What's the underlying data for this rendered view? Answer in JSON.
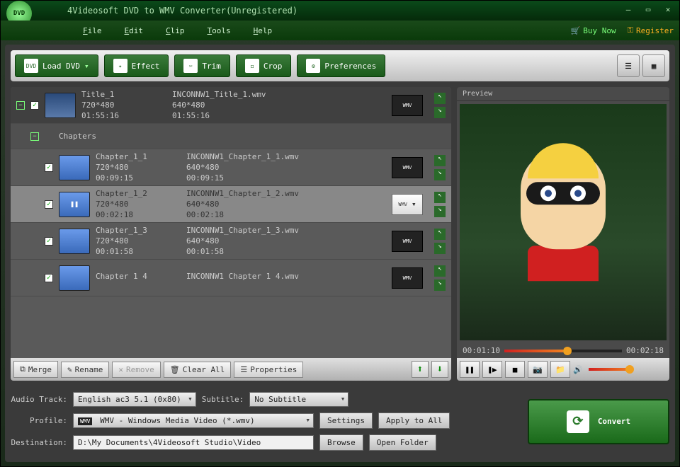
{
  "window": {
    "title": "4Videosoft DVD to WMV Converter(Unregistered)",
    "logo_text": "DVD"
  },
  "menu": {
    "file": "File",
    "edit": "Edit",
    "clip": "Clip",
    "tools": "Tools",
    "help": "Help",
    "buy_now": "Buy Now",
    "register": "Register"
  },
  "toolbar": {
    "load_dvd": "Load DVD",
    "effect": "Effect",
    "trim": "Trim",
    "crop": "Crop",
    "preferences": "Preferences"
  },
  "files": {
    "title_row": {
      "name": "Title_1",
      "resolution": "720*480",
      "duration": "01:55:16",
      "out_name": "INCONNW1_Title_1.wmv",
      "out_resolution": "640*480",
      "out_duration": "01:55:16"
    },
    "chapters_header": "Chapters",
    "chapters": [
      {
        "name": "Chapter_1_1",
        "resolution": "720*480",
        "duration": "00:09:15",
        "out_name": "INCONNW1_Chapter_1_1.wmv",
        "out_resolution": "640*480",
        "out_duration": "00:09:15",
        "selected": false
      },
      {
        "name": "Chapter_1_2",
        "resolution": "720*480",
        "duration": "00:02:18",
        "out_name": "INCONNW1_Chapter_1_2.wmv",
        "out_resolution": "640*480",
        "out_duration": "00:02:18",
        "selected": true
      },
      {
        "name": "Chapter_1_3",
        "resolution": "720*480",
        "duration": "00:01:58",
        "out_name": "INCONNW1_Chapter_1_3.wmv",
        "out_resolution": "640*480",
        "out_duration": "00:01:58",
        "selected": false
      },
      {
        "name": "Chapter 1 4",
        "resolution": "",
        "duration": "",
        "out_name": "INCONNW1 Chapter 1 4.wmv",
        "out_resolution": "",
        "out_duration": "",
        "selected": false
      }
    ]
  },
  "list_toolbar": {
    "merge": "Merge",
    "rename": "Rename",
    "remove": "Remove",
    "clear_all": "Clear All",
    "properties": "Properties"
  },
  "preview": {
    "label": "Preview",
    "current_time": "00:01:10",
    "total_time": "00:02:18"
  },
  "settings": {
    "audio_track_label": "Audio Track:",
    "audio_track_value": "English ac3 5.1 (0x80)",
    "subtitle_label": "Subtitle:",
    "subtitle_value": "No Subtitle",
    "profile_label": "Profile:",
    "profile_value": "WMV - Windows Media Video (*.wmv)",
    "destination_label": "Destination:",
    "destination_value": "D:\\My Documents\\4Videosoft Studio\\Video",
    "settings_btn": "Settings",
    "apply_to_all_btn": "Apply to All",
    "browse_btn": "Browse",
    "open_folder_btn": "Open Folder"
  },
  "convert_label": "Convert",
  "profile_badge": "WMV"
}
